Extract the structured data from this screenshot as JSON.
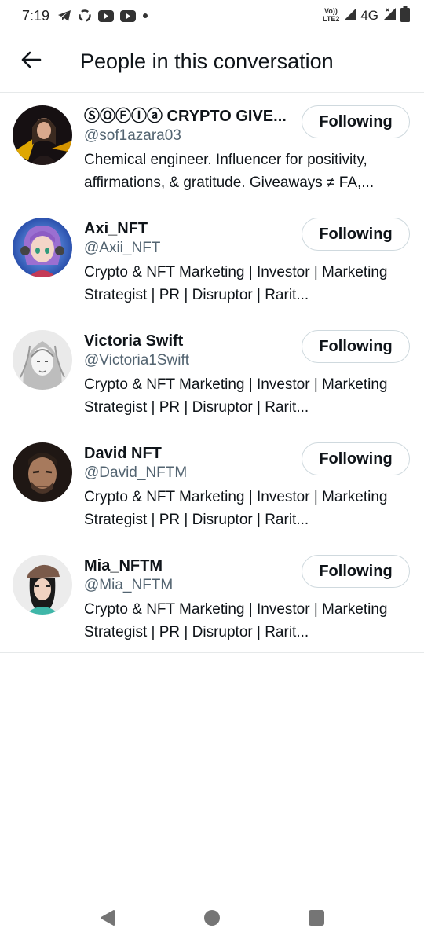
{
  "status_bar": {
    "time": "7:19",
    "network": "4G",
    "volte": "VoLTE2",
    "icons": [
      "telegram-icon",
      "recycle-icon",
      "youtube-icon",
      "youtube-icon",
      "dot-icon",
      "signal-icon",
      "wifi-signal-icon",
      "battery-icon"
    ]
  },
  "header": {
    "title": "People in this conversation",
    "back_icon": "arrow-left-icon"
  },
  "people": [
    {
      "name": "ⓈⓄⒻⒾⓐ CRYPTO GIVE...",
      "handle": "@sof1azara03",
      "bio": "Chemical engineer. Influencer for positivity, affirmations, & gratitude. Giveaways ≠ FA,...",
      "button": "Following",
      "avatar_colors": [
        "#1a1416",
        "#f5b800"
      ]
    },
    {
      "name": "Axi_NFT",
      "handle": "@Axii_NFT",
      "bio": "Crypto & NFT Marketing | Investor | Marketing Strategist | PR | Disruptor | Rarit...",
      "button": "Following",
      "avatar_colors": [
        "#2a4fb5",
        "#9b6fd1"
      ]
    },
    {
      "name": "Victoria Swift",
      "handle": "@Victoria1Swift",
      "bio": "Crypto & NFT Marketing | Investor | Marketing Strategist | PR | Disruptor | Rarit...",
      "button": "Following",
      "avatar_colors": [
        "#e8e8e8",
        "#9a9a9a"
      ]
    },
    {
      "name": "David NFT",
      "handle": "@David_NFTM",
      "bio": "Crypto & NFT Marketing | Investor | Marketing Strategist | PR | Disruptor | Rarit...",
      "button": "Following",
      "avatar_colors": [
        "#2b211c",
        "#a77a5d"
      ]
    },
    {
      "name": "Mia_NFTM",
      "handle": "@Mia_NFTM",
      "bio": "Crypto & NFT Marketing | Investor | Marketing Strategist | PR | Disruptor | Rarit...",
      "button": "Following",
      "avatar_colors": [
        "#e9e9e9",
        "#3fb6a8"
      ]
    }
  ],
  "nav_bar": {
    "icons": [
      "back-triangle-icon",
      "home-circle-icon",
      "recents-square-icon"
    ]
  }
}
